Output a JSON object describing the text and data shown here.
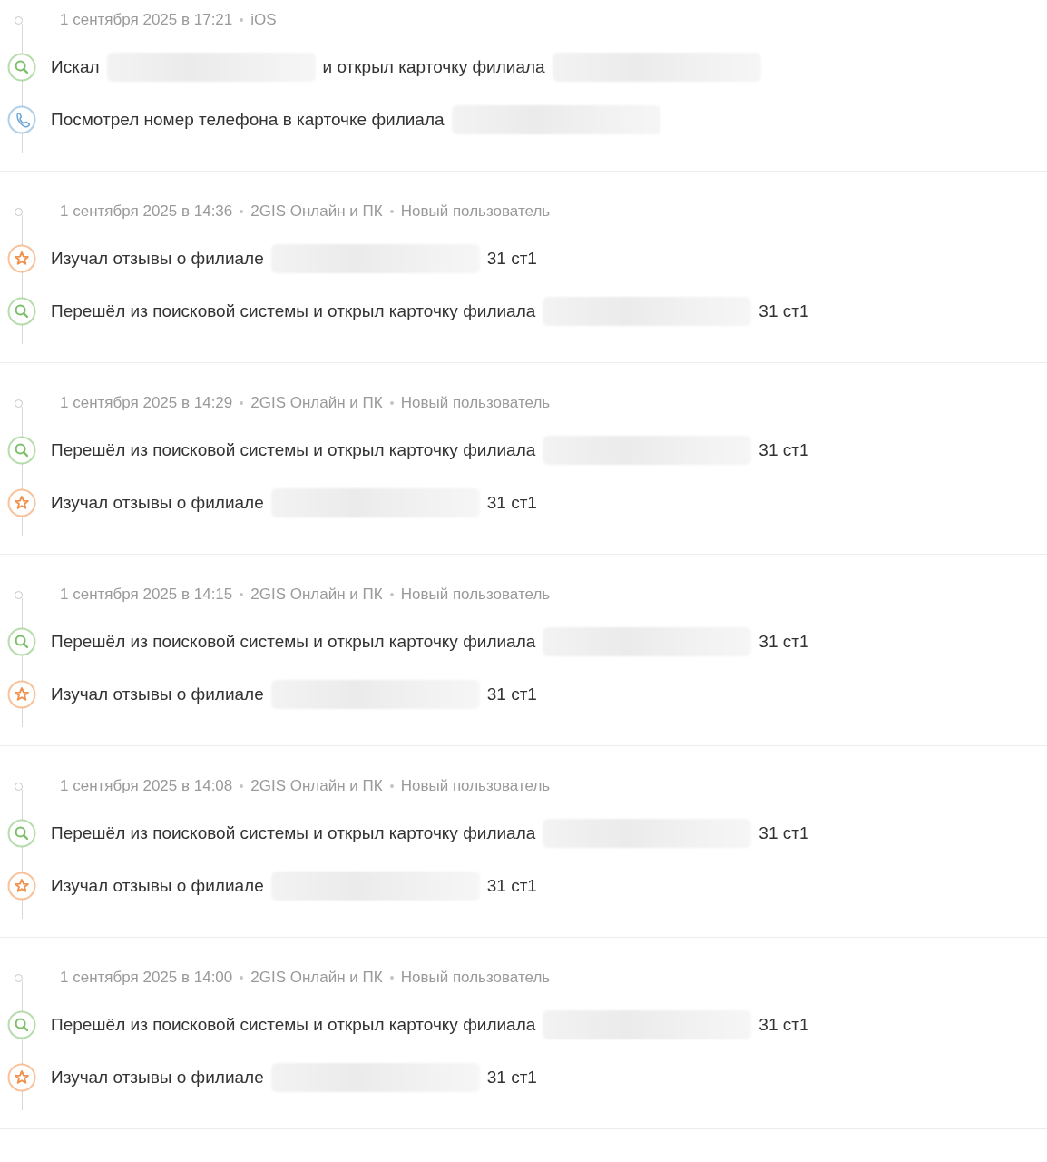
{
  "sessions": [
    {
      "date": "1 сентября 2025 в 17:21",
      "platform": "iOS",
      "events": [
        {
          "kind": "search",
          "parts": [
            {
              "kind": "text",
              "text": "Искал"
            },
            {
              "kind": "redacted"
            },
            {
              "kind": "text",
              "text": "и открыл карточку филиала"
            },
            {
              "kind": "redacted"
            }
          ]
        },
        {
          "kind": "phone",
          "parts": [
            {
              "kind": "text",
              "text": "Посмотрел номер телефона в карточке филиала"
            },
            {
              "kind": "redacted"
            }
          ]
        }
      ]
    },
    {
      "date": "1 сентября 2025 в 14:36",
      "platform": "2GIS Онлайн и ПК",
      "user_type": "Новый пользователь",
      "events": [
        {
          "kind": "review",
          "parts": [
            {
              "kind": "text",
              "text": "Изучал отзывы о филиале"
            },
            {
              "kind": "redacted"
            },
            {
              "kind": "text",
              "text": "31 ст1"
            }
          ]
        },
        {
          "kind": "search",
          "parts": [
            {
              "kind": "text",
              "text": "Перешёл из поисковой системы и открыл карточку филиала"
            },
            {
              "kind": "redacted"
            },
            {
              "kind": "text",
              "text": "31 ст1"
            }
          ]
        }
      ]
    },
    {
      "date": "1 сентября 2025 в 14:29",
      "platform": "2GIS Онлайн и ПК",
      "user_type": "Новый пользователь",
      "events": [
        {
          "kind": "search",
          "parts": [
            {
              "kind": "text",
              "text": "Перешёл из поисковой системы и открыл карточку филиала"
            },
            {
              "kind": "redacted"
            },
            {
              "kind": "text",
              "text": "31 ст1"
            }
          ]
        },
        {
          "kind": "review",
          "parts": [
            {
              "kind": "text",
              "text": "Изучал отзывы о филиале"
            },
            {
              "kind": "redacted"
            },
            {
              "kind": "text",
              "text": "31 ст1"
            }
          ]
        }
      ]
    },
    {
      "date": "1 сентября 2025 в 14:15",
      "platform": "2GIS Онлайн и ПК",
      "user_type": "Новый пользователь",
      "events": [
        {
          "kind": "search",
          "parts": [
            {
              "kind": "text",
              "text": "Перешёл из поисковой системы и открыл карточку филиала"
            },
            {
              "kind": "redacted"
            },
            {
              "kind": "text",
              "text": "31 ст1"
            }
          ]
        },
        {
          "kind": "review",
          "parts": [
            {
              "kind": "text",
              "text": "Изучал отзывы о филиале"
            },
            {
              "kind": "redacted"
            },
            {
              "kind": "text",
              "text": "31 ст1"
            }
          ]
        }
      ]
    },
    {
      "date": "1 сентября 2025 в 14:08",
      "platform": "2GIS Онлайн и ПК",
      "user_type": "Новый пользователь",
      "events": [
        {
          "kind": "search",
          "parts": [
            {
              "kind": "text",
              "text": "Перешёл из поисковой системы и открыл карточку филиала"
            },
            {
              "kind": "redacted"
            },
            {
              "kind": "text",
              "text": "31 ст1"
            }
          ]
        },
        {
          "kind": "review",
          "parts": [
            {
              "kind": "text",
              "text": "Изучал отзывы о филиале"
            },
            {
              "kind": "redacted"
            },
            {
              "kind": "text",
              "text": "31 ст1"
            }
          ]
        }
      ]
    },
    {
      "date": "1 сентября 2025 в 14:00",
      "platform": "2GIS Онлайн и ПК",
      "user_type": "Новый пользователь",
      "events": [
        {
          "kind": "search",
          "parts": [
            {
              "kind": "text",
              "text": "Перешёл из поисковой системы и открыл карточку филиала"
            },
            {
              "kind": "redacted"
            },
            {
              "kind": "text",
              "text": "31 ст1"
            }
          ]
        },
        {
          "kind": "review",
          "parts": [
            {
              "kind": "text",
              "text": "Изучал отзывы о филиале"
            },
            {
              "kind": "redacted"
            },
            {
              "kind": "text",
              "text": "31 ст1"
            }
          ]
        }
      ]
    }
  ]
}
